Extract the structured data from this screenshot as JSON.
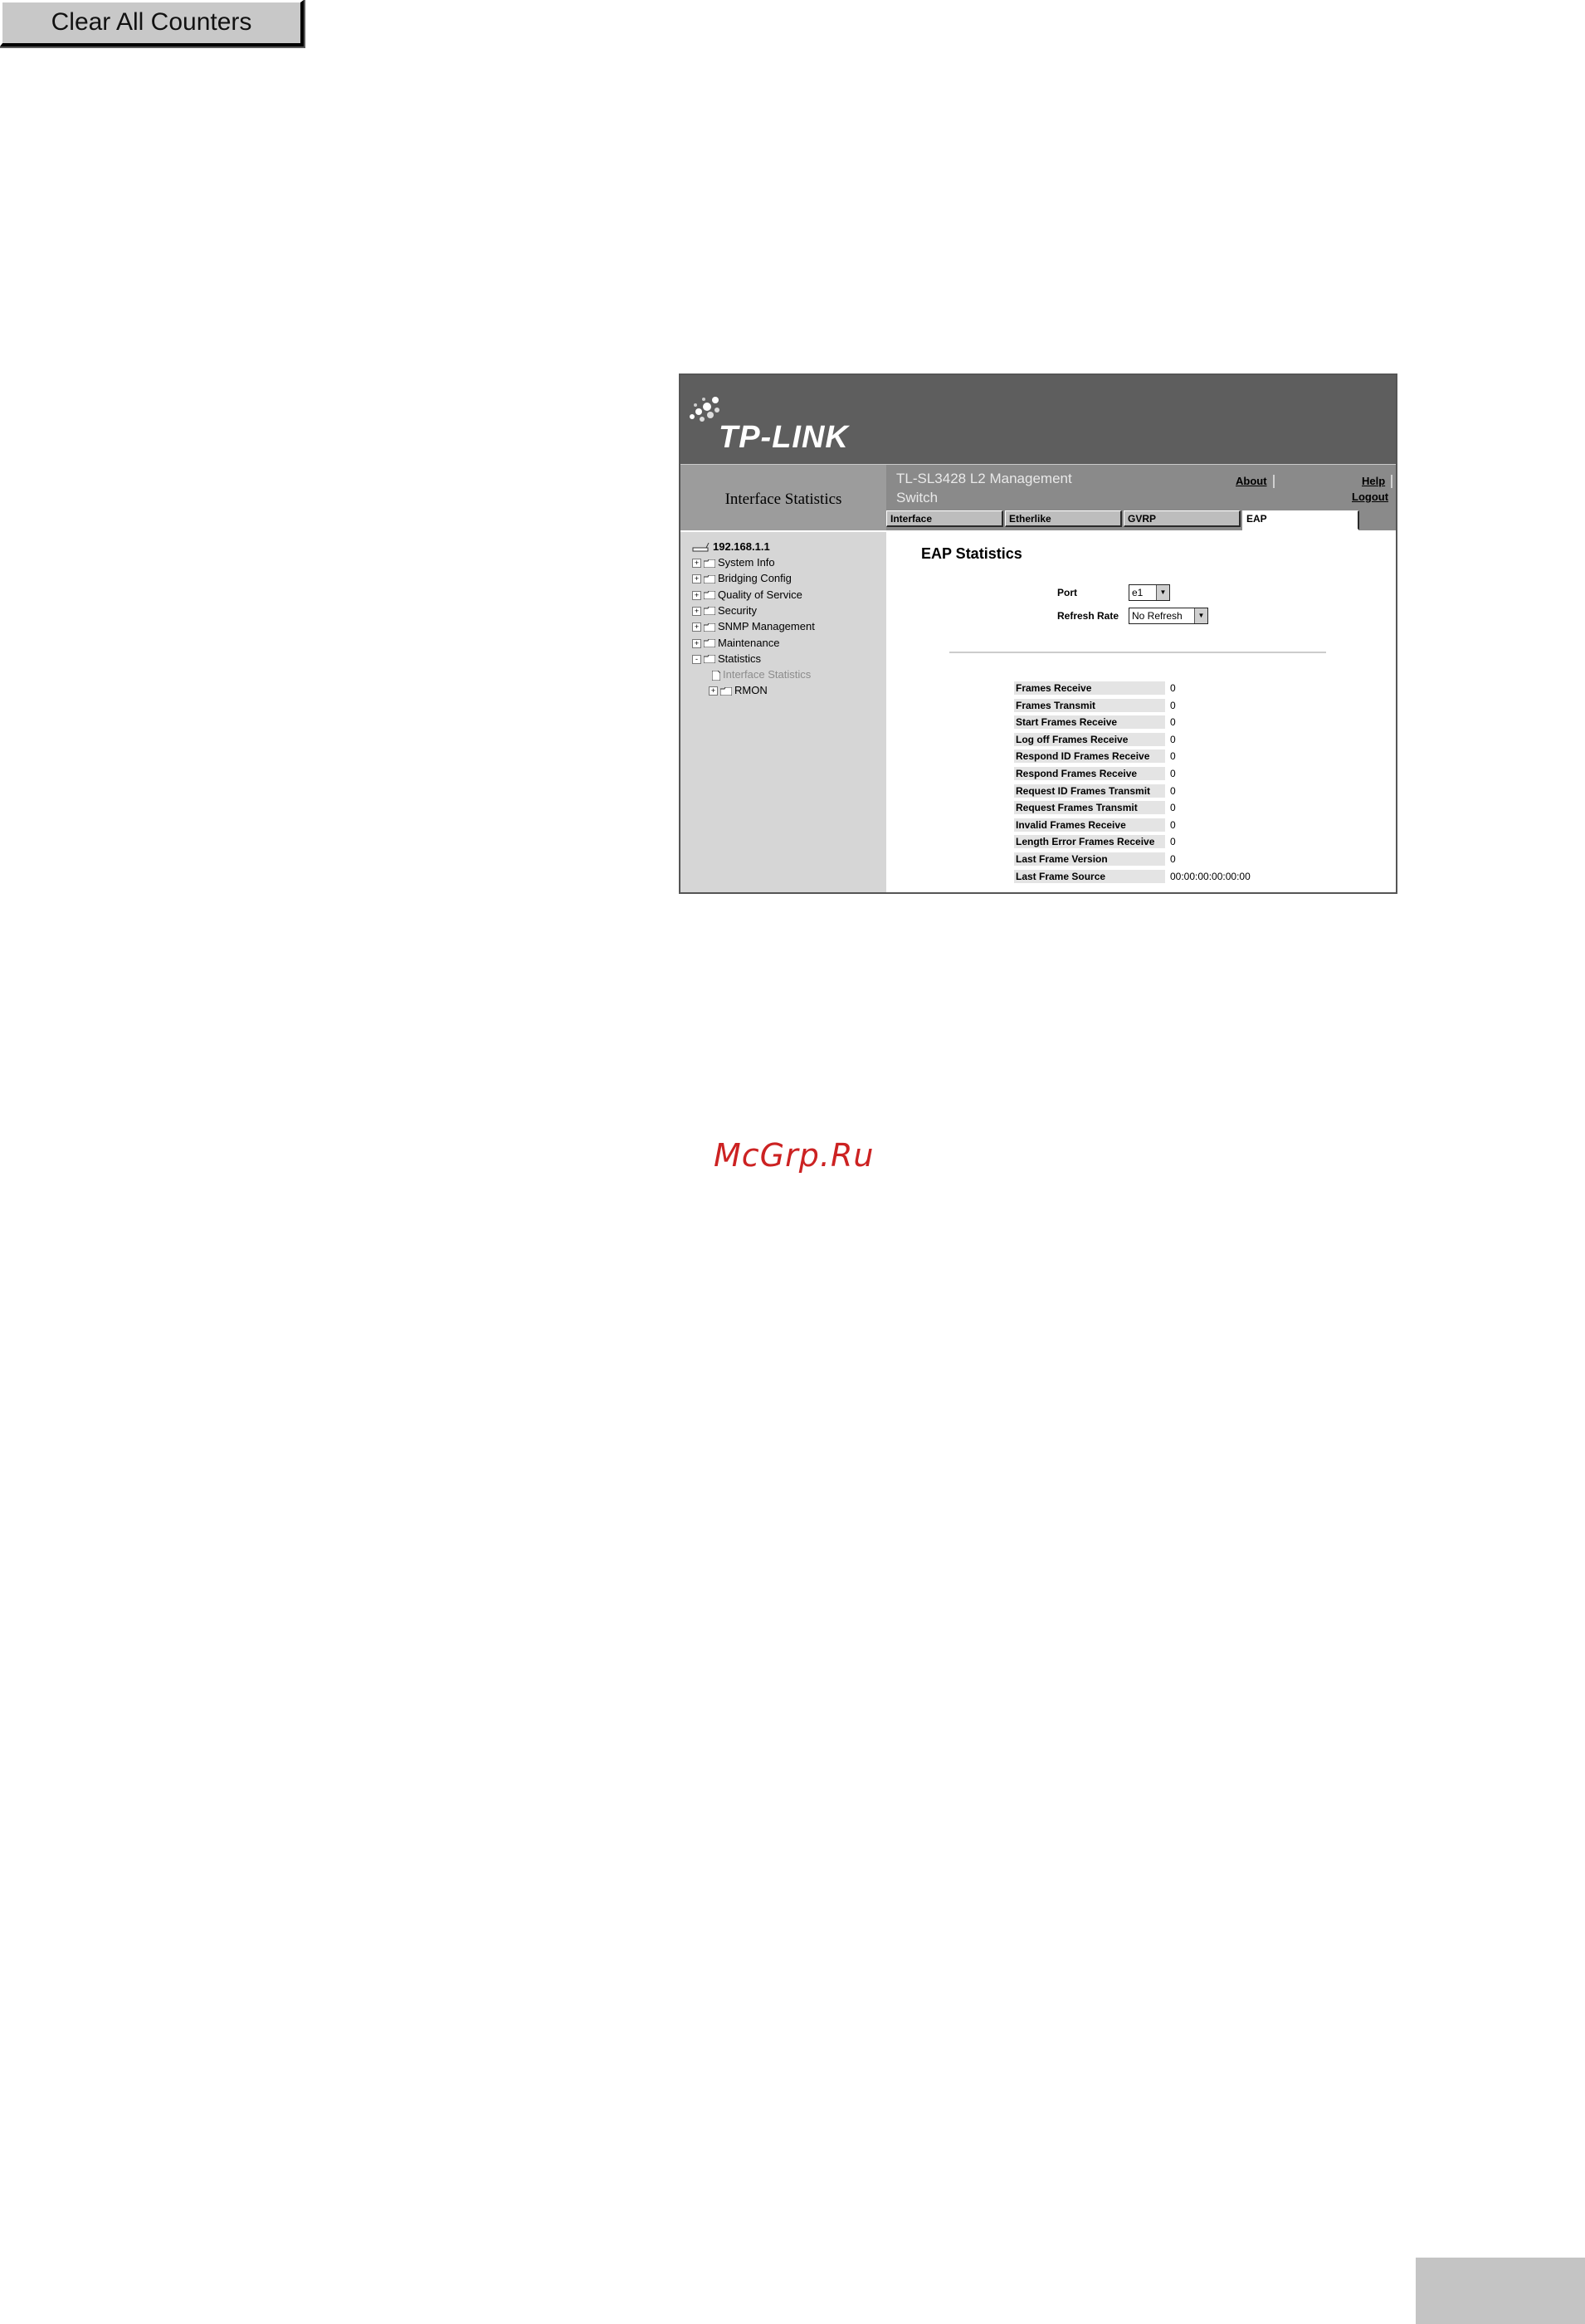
{
  "top_button": {
    "label": "Clear All Counters"
  },
  "app": {
    "brand": "TP-LINK",
    "page_header": "Interface Statistics",
    "product_name": "TL-SL3428 L2 Management Switch",
    "links": {
      "about": "About",
      "help": "Help",
      "logout": "Logout"
    }
  },
  "tabs": [
    {
      "label": "Interface",
      "active": false
    },
    {
      "label": "Etherlike",
      "active": false
    },
    {
      "label": "GVRP",
      "active": false
    },
    {
      "label": "EAP",
      "active": true
    }
  ],
  "tree": {
    "root": "192.168.1.1",
    "items": [
      {
        "label": "System Info",
        "expander": "+"
      },
      {
        "label": "Bridging Config",
        "expander": "+"
      },
      {
        "label": "Quality of Service",
        "expander": "+"
      },
      {
        "label": "Security",
        "expander": "+"
      },
      {
        "label": "SNMP Management",
        "expander": "+"
      },
      {
        "label": "Maintenance",
        "expander": "+"
      },
      {
        "label": "Statistics",
        "expander": "-"
      }
    ],
    "subitem": "Interface Statistics",
    "rmon": {
      "label": "RMON",
      "expander": "+"
    }
  },
  "content": {
    "title": "EAP Statistics",
    "port": {
      "label": "Port",
      "value": "e1"
    },
    "refresh": {
      "label": "Refresh Rate",
      "value": "No Refresh"
    },
    "stats": [
      {
        "label": "Frames Receive",
        "value": "0"
      },
      {
        "label": "Frames Transmit",
        "value": "0"
      },
      {
        "label": "Start Frames Receive",
        "value": "0"
      },
      {
        "label": "Log off Frames Receive",
        "value": "0"
      },
      {
        "label": "Respond ID Frames Receive",
        "value": "0"
      },
      {
        "label": "Respond Frames Receive",
        "value": "0"
      },
      {
        "label": "Request ID Frames Transmit",
        "value": "0"
      },
      {
        "label": "Request Frames Transmit",
        "value": "0"
      },
      {
        "label": "Invalid Frames Receive",
        "value": "0"
      },
      {
        "label": "Length Error Frames Receive",
        "value": "0"
      },
      {
        "label": "Last Frame Version",
        "value": "0"
      },
      {
        "label": "Last Frame Source",
        "value": "00:00:00:00:00:00"
      }
    ]
  },
  "watermark": "McGrp.Ru"
}
